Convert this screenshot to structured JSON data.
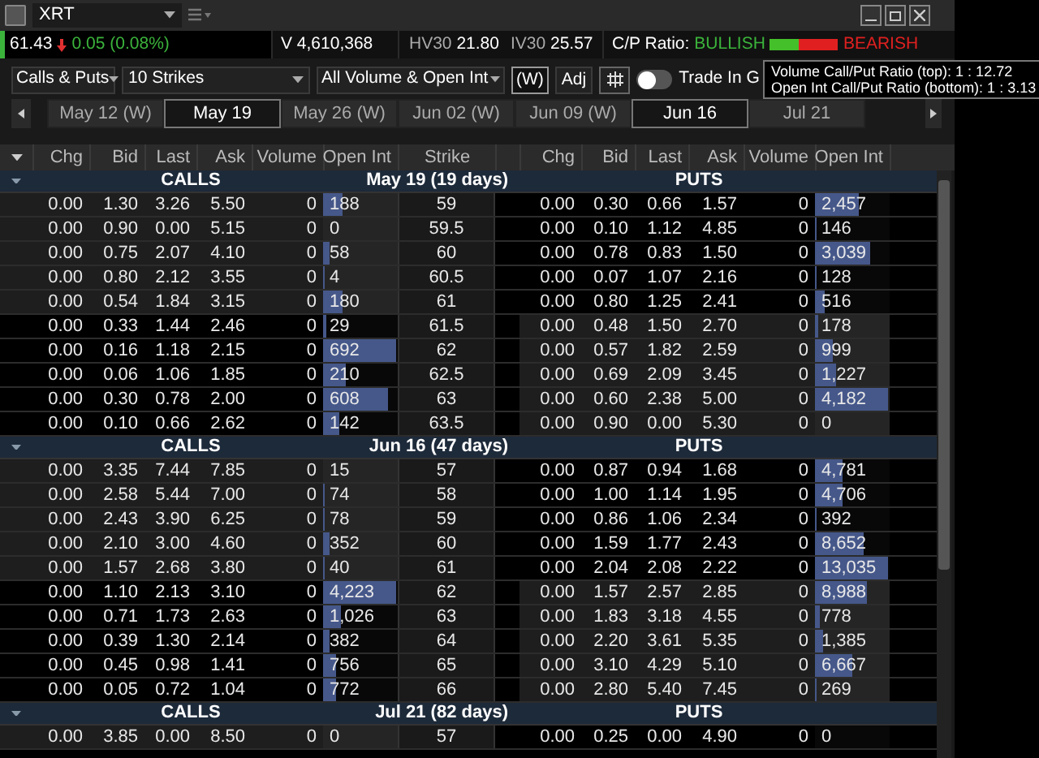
{
  "window": {
    "symbol": "XRT"
  },
  "quote": {
    "last": "61.43",
    "change": "0.05 (0.08%)",
    "down": true,
    "volume": "V 4,610,368",
    "hv30_label": "HV30",
    "hv30": "21.80",
    "iv30_label": "IV30",
    "iv30": "25.57",
    "cp_label": "C/P Ratio:",
    "bullish": "BULLISH",
    "bearish": "BEARISH",
    "level": 0.42
  },
  "toolbar": {
    "type": "Calls & Puts",
    "strikes": "10 Strikes",
    "filter": "All Volume & Open Int",
    "weekly": "(W)",
    "adjusted": "Adj",
    "trade_toggle": {
      "label": "Trade In G",
      "on": false
    }
  },
  "tooltip": [
    "Volume Call/Put Ratio (top): 1 : 12.72",
    "Open Int Call/Put Ratio (bottom): 1 : 3.13"
  ],
  "expirations": [
    {
      "label": "May 12 (W)",
      "selected": false
    },
    {
      "label": "May 19",
      "selected": true
    },
    {
      "label": "May 26 (W)",
      "selected": false
    },
    {
      "label": "Jun 02 (W)",
      "selected": false
    },
    {
      "label": "Jun 09 (W)",
      "selected": false
    },
    {
      "label": "Jun 16",
      "selected": true
    },
    {
      "label": "Jul 21",
      "selected": false
    }
  ],
  "columns": {
    "calls": [
      "Chg",
      "Bid",
      "Last",
      "Ask",
      "Volume",
      "Open Int"
    ],
    "strike": "Strike",
    "puts": [
      "Chg",
      "Bid",
      "Last",
      "Ask",
      "Volume",
      "Open Int"
    ]
  },
  "sections": [
    {
      "calls_label": "CALLS",
      "date": "May 19 (19 days)",
      "puts_label": "PUTS",
      "rows": [
        {
          "call": {
            "cells": [
              "0.00",
              "1.30",
              "3.26",
              "5.50",
              "0",
              "188"
            ],
            "level": 0.27,
            "shaded": true
          },
          "strike": "59",
          "put": {
            "cells": [
              "0.00",
              "0.30",
              "0.66",
              "1.57",
              "0",
              "2,457"
            ],
            "level": 0.59,
            "shaded": false
          }
        },
        {
          "call": {
            "cells": [
              "0.00",
              "0.90",
              "0.00",
              "5.15",
              "0",
              "0"
            ],
            "shaded": true
          },
          "strike": "59.5",
          "put": {
            "cells": [
              "0.00",
              "0.10",
              "1.12",
              "4.85",
              "0",
              "146"
            ],
            "level": 0.03,
            "shaded": false
          }
        },
        {
          "call": {
            "cells": [
              "0.00",
              "0.75",
              "2.07",
              "4.10",
              "0",
              "58"
            ],
            "level": 0.08,
            "shaded": true
          },
          "strike": "60",
          "put": {
            "cells": [
              "0.00",
              "0.78",
              "0.83",
              "1.50",
              "0",
              "3,039"
            ],
            "level": 0.73,
            "shaded": false
          }
        },
        {
          "call": {
            "cells": [
              "0.00",
              "0.80",
              "2.12",
              "3.55",
              "0",
              "4"
            ],
            "level": 0.01,
            "shaded": true
          },
          "strike": "60.5",
          "put": {
            "cells": [
              "0.00",
              "0.07",
              "1.07",
              "2.16",
              "0",
              "128"
            ],
            "level": 0.03,
            "shaded": false
          }
        },
        {
          "call": {
            "cells": [
              "0.00",
              "0.54",
              "1.84",
              "3.15",
              "0",
              "180"
            ],
            "level": 0.26,
            "shaded": true
          },
          "strike": "61",
          "put": {
            "cells": [
              "0.00",
              "0.80",
              "1.25",
              "2.41",
              "0",
              "516"
            ],
            "level": 0.12,
            "shaded": false
          }
        },
        {
          "call": {
            "cells": [
              "0.00",
              "0.33",
              "1.44",
              "2.46",
              "0",
              "29"
            ],
            "level": 0.04,
            "shaded": false
          },
          "strike": "61.5",
          "put": {
            "cells": [
              "0.00",
              "0.48",
              "1.50",
              "2.70",
              "0",
              "178"
            ],
            "level": 0.04,
            "shaded": true
          }
        },
        {
          "call": {
            "cells": [
              "0.00",
              "0.16",
              "1.18",
              "2.15",
              "0",
              "692"
            ],
            "level": 0.97,
            "shaded": false
          },
          "strike": "62",
          "put": {
            "cells": [
              "0.00",
              "0.57",
              "1.82",
              "2.59",
              "0",
              "999"
            ],
            "level": 0.24,
            "shaded": true
          }
        },
        {
          "call": {
            "cells": [
              "0.00",
              "0.06",
              "1.06",
              "1.85",
              "0",
              "210"
            ],
            "level": 0.3,
            "shaded": false
          },
          "strike": "62.5",
          "put": {
            "cells": [
              "0.00",
              "0.69",
              "2.09",
              "3.45",
              "0",
              "1,227"
            ],
            "level": 0.29,
            "shaded": true
          }
        },
        {
          "call": {
            "cells": [
              "0.00",
              "0.30",
              "0.78",
              "2.00",
              "0",
              "608"
            ],
            "level": 0.88,
            "shaded": false
          },
          "strike": "63",
          "put": {
            "cells": [
              "0.00",
              "0.60",
              "2.38",
              "5.00",
              "0",
              "4,182"
            ],
            "level": 0.97,
            "shaded": true
          }
        },
        {
          "call": {
            "cells": [
              "0.00",
              "0.10",
              "0.66",
              "2.62",
              "0",
              "142"
            ],
            "level": 0.21,
            "shaded": false
          },
          "strike": "63.5",
          "put": {
            "cells": [
              "0.00",
              "0.90",
              "0.00",
              "5.30",
              "0",
              "0"
            ],
            "shaded": true
          }
        }
      ]
    },
    {
      "calls_label": "CALLS",
      "date": "Jun 16 (47 days)",
      "puts_label": "PUTS",
      "rows": [
        {
          "call": {
            "cells": [
              "0.00",
              "3.35",
              "7.44",
              "7.85",
              "0",
              "15"
            ],
            "shaded": true
          },
          "strike": "57",
          "put": {
            "cells": [
              "0.00",
              "0.87",
              "0.94",
              "1.68",
              "0",
              "4,781"
            ],
            "level": 0.37,
            "shaded": false
          }
        },
        {
          "call": {
            "cells": [
              "0.00",
              "2.58",
              "5.44",
              "7.00",
              "0",
              "74"
            ],
            "level": 0.02,
            "shaded": true
          },
          "strike": "58",
          "put": {
            "cells": [
              "0.00",
              "1.00",
              "1.14",
              "1.95",
              "0",
              "4,706"
            ],
            "level": 0.36,
            "shaded": false
          }
        },
        {
          "call": {
            "cells": [
              "0.00",
              "2.43",
              "3.90",
              "6.25",
              "0",
              "78"
            ],
            "level": 0.02,
            "shaded": true
          },
          "strike": "59",
          "put": {
            "cells": [
              "0.00",
              "0.86",
              "1.06",
              "2.34",
              "0",
              "392"
            ],
            "level": 0.03,
            "shaded": false
          }
        },
        {
          "call": {
            "cells": [
              "0.00",
              "2.10",
              "3.00",
              "4.60",
              "0",
              "352"
            ],
            "level": 0.08,
            "shaded": true
          },
          "strike": "60",
          "put": {
            "cells": [
              "0.00",
              "1.59",
              "1.77",
              "2.43",
              "0",
              "8,652"
            ],
            "level": 0.66,
            "shaded": false
          }
        },
        {
          "call": {
            "cells": [
              "0.00",
              "1.57",
              "2.68",
              "3.80",
              "0",
              "40"
            ],
            "level": 0.01,
            "shaded": true
          },
          "strike": "61",
          "put": {
            "cells": [
              "0.00",
              "2.04",
              "2.08",
              "2.22",
              "0",
              "13,035"
            ],
            "level": 0.97,
            "shaded": false
          }
        },
        {
          "call": {
            "cells": [
              "0.00",
              "1.10",
              "2.13",
              "3.10",
              "0",
              "4,223"
            ],
            "level": 0.97,
            "shaded": false
          },
          "strike": "62",
          "put": {
            "cells": [
              "0.00",
              "1.57",
              "2.57",
              "2.85",
              "0",
              "8,988"
            ],
            "level": 0.69,
            "shaded": true
          }
        },
        {
          "call": {
            "cells": [
              "0.00",
              "0.71",
              "1.73",
              "2.63",
              "0",
              "1,026"
            ],
            "level": 0.24,
            "shaded": false
          },
          "strike": "63",
          "put": {
            "cells": [
              "0.00",
              "1.83",
              "3.18",
              "4.55",
              "0",
              "778"
            ],
            "level": 0.06,
            "shaded": true
          }
        },
        {
          "call": {
            "cells": [
              "0.00",
              "0.39",
              "1.30",
              "2.14",
              "0",
              "382"
            ],
            "level": 0.09,
            "shaded": false
          },
          "strike": "64",
          "put": {
            "cells": [
              "0.00",
              "2.20",
              "3.61",
              "5.35",
              "0",
              "1,385"
            ],
            "level": 0.11,
            "shaded": true
          }
        },
        {
          "call": {
            "cells": [
              "0.00",
              "0.45",
              "0.98",
              "1.41",
              "0",
              "756"
            ],
            "level": 0.18,
            "shaded": false
          },
          "strike": "65",
          "put": {
            "cells": [
              "0.00",
              "3.10",
              "4.29",
              "5.10",
              "0",
              "6,667"
            ],
            "level": 0.51,
            "shaded": true
          }
        },
        {
          "call": {
            "cells": [
              "0.00",
              "0.05",
              "0.72",
              "1.04",
              "0",
              "772"
            ],
            "level": 0.18,
            "shaded": false
          },
          "strike": "66",
          "put": {
            "cells": [
              "0.00",
              "2.80",
              "5.40",
              "7.45",
              "0",
              "269"
            ],
            "level": 0.02,
            "shaded": true
          }
        }
      ]
    },
    {
      "calls_label": "CALLS",
      "date": "Jul 21 (82 days)",
      "puts_label": "PUTS",
      "rows": [
        {
          "call": {
            "cells": [
              "0.00",
              "3.85",
              "0.00",
              "8.50",
              "0",
              "0"
            ],
            "shaded": true
          },
          "strike": "57",
          "put": {
            "cells": [
              "0.00",
              "0.25",
              "0.00",
              "4.90",
              "0",
              "0"
            ],
            "shaded": false
          }
        }
      ]
    }
  ]
}
